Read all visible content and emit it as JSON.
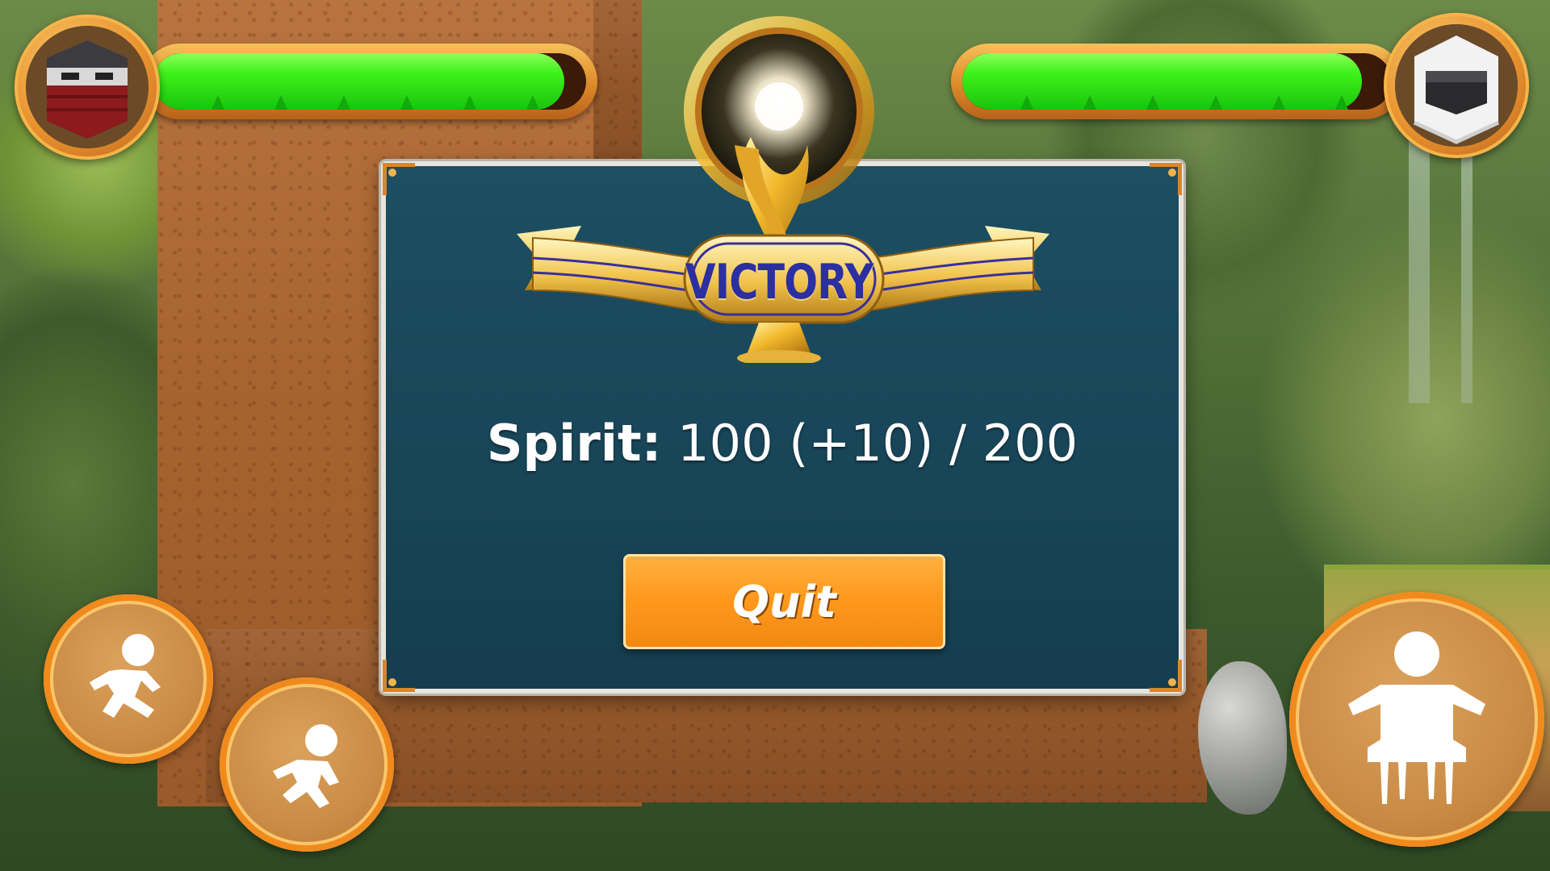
{
  "hud": {
    "player": {
      "name": "red-ninja",
      "health_fraction": 0.95
    },
    "opponent": {
      "name": "white-ninja",
      "health_fraction": 0.93
    }
  },
  "dialog": {
    "banner_text": "VICTORY",
    "spirit_label": "Spirit:",
    "spirit_value": "100 (+10) / 200",
    "quit_label": "Quit"
  },
  "controls": {
    "left": [
      "run-action",
      "crouch-run-action"
    ],
    "right": "jump-action"
  },
  "colors": {
    "health_green": "#3ef21a",
    "frame_orange": "#e9932e",
    "dialog_bg": "#1d4e62",
    "button_orange": "#ff9a1e",
    "banner_text": "#2b2fa0"
  }
}
